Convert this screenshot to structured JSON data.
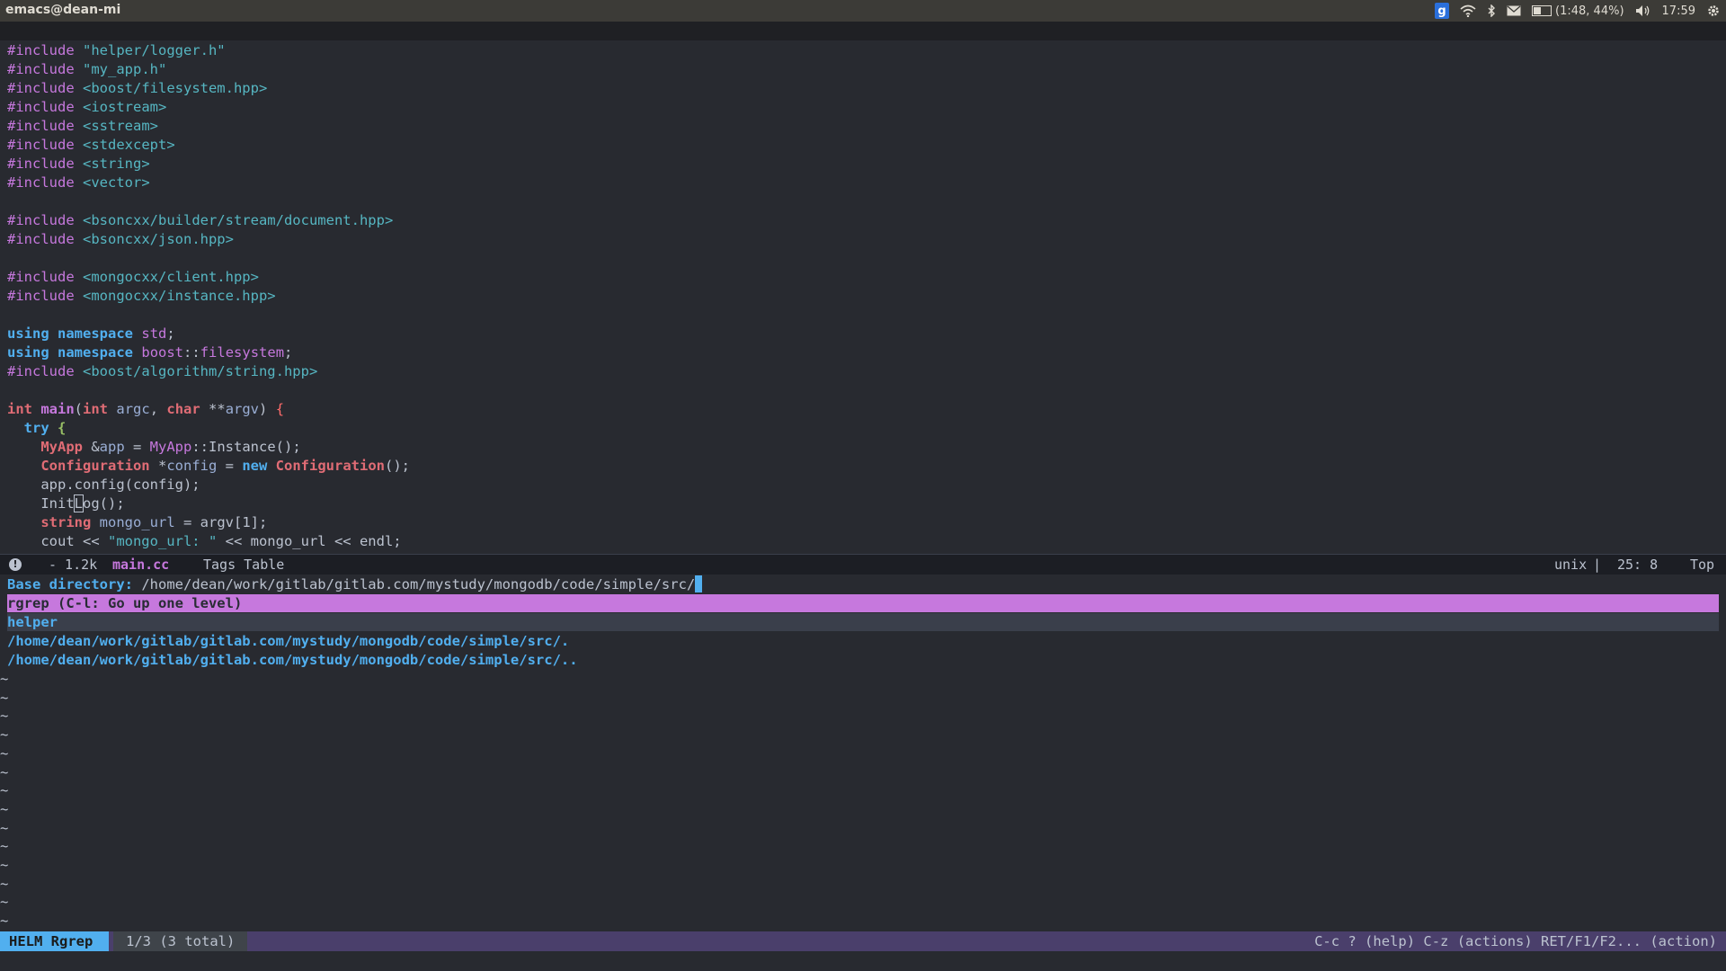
{
  "topbar": {
    "title": "emacs@dean-mi",
    "battery": "(1:48, 44%)",
    "battery_level": 0.44,
    "time": "17:59",
    "icons": [
      "g-indicator-icon",
      "wifi-icon",
      "bluetooth-icon",
      "mail-icon",
      "battery-icon",
      "volume-icon",
      "gear-icon"
    ]
  },
  "editor": {
    "lines": [
      [
        {
          "c": "pp",
          "t": "#include "
        },
        {
          "c": "str",
          "t": "\"helper/logger.h\""
        }
      ],
      [
        {
          "c": "pp",
          "t": "#include "
        },
        {
          "c": "str",
          "t": "\"my_app.h\""
        }
      ],
      [
        {
          "c": "pp",
          "t": "#include "
        },
        {
          "c": "str",
          "t": "<boost/filesystem.hpp>"
        }
      ],
      [
        {
          "c": "pp",
          "t": "#include "
        },
        {
          "c": "str",
          "t": "<iostream>"
        }
      ],
      [
        {
          "c": "pp",
          "t": "#include "
        },
        {
          "c": "str",
          "t": "<sstream>"
        }
      ],
      [
        {
          "c": "pp",
          "t": "#include "
        },
        {
          "c": "str",
          "t": "<stdexcept>"
        }
      ],
      [
        {
          "c": "pp",
          "t": "#include "
        },
        {
          "c": "str",
          "t": "<string>"
        }
      ],
      [
        {
          "c": "pp",
          "t": "#include "
        },
        {
          "c": "str",
          "t": "<vector>"
        }
      ],
      [],
      [
        {
          "c": "pp",
          "t": "#include "
        },
        {
          "c": "str",
          "t": "<bsoncxx/builder/stream/document.hpp>"
        }
      ],
      [
        {
          "c": "pp",
          "t": "#include "
        },
        {
          "c": "str",
          "t": "<bsoncxx/json.hpp>"
        }
      ],
      [],
      [
        {
          "c": "pp",
          "t": "#include "
        },
        {
          "c": "str",
          "t": "<mongocxx/client.hpp>"
        }
      ],
      [
        {
          "c": "pp",
          "t": "#include "
        },
        {
          "c": "str",
          "t": "<mongocxx/instance.hpp>"
        }
      ],
      [],
      [
        {
          "c": "kw",
          "t": "using"
        },
        {
          "c": "",
          "t": " "
        },
        {
          "c": "kw",
          "t": "namespace"
        },
        {
          "c": "",
          "t": " "
        },
        {
          "c": "ns",
          "t": "std"
        },
        {
          "c": "",
          "t": ";"
        }
      ],
      [
        {
          "c": "kw",
          "t": "using"
        },
        {
          "c": "",
          "t": " "
        },
        {
          "c": "kw",
          "t": "namespace"
        },
        {
          "c": "",
          "t": " "
        },
        {
          "c": "ns",
          "t": "boost"
        },
        {
          "c": "",
          "t": "::"
        },
        {
          "c": "ns",
          "t": "filesystem"
        },
        {
          "c": "",
          "t": ";"
        }
      ],
      [
        {
          "c": "pp",
          "t": "#include "
        },
        {
          "c": "str",
          "t": "<boost/algorithm/string.hpp>"
        }
      ],
      [],
      [
        {
          "c": "type",
          "t": "int"
        },
        {
          "c": "",
          "t": " "
        },
        {
          "c": "fn",
          "t": "main"
        },
        {
          "c": "",
          "t": "("
        },
        {
          "c": "type",
          "t": "int"
        },
        {
          "c": "",
          "t": " "
        },
        {
          "c": "var",
          "t": "argc"
        },
        {
          "c": "",
          "t": ", "
        },
        {
          "c": "type",
          "t": "char"
        },
        {
          "c": "",
          "t": " **"
        },
        {
          "c": "var",
          "t": "argv"
        },
        {
          "c": "",
          "t": ") "
        },
        {
          "c": "br",
          "t": "{"
        }
      ],
      [
        {
          "c": "",
          "t": "  "
        },
        {
          "c": "kw",
          "t": "try"
        },
        {
          "c": "",
          "t": " "
        },
        {
          "c": "green",
          "t": "{"
        }
      ],
      [
        {
          "c": "",
          "t": "    "
        },
        {
          "c": "type",
          "t": "MyApp"
        },
        {
          "c": "",
          "t": " &"
        },
        {
          "c": "var",
          "t": "app"
        },
        {
          "c": "",
          "t": " = "
        },
        {
          "c": "tp",
          "t": "MyApp"
        },
        {
          "c": "",
          "t": "::Instance();"
        }
      ],
      [
        {
          "c": "",
          "t": "    "
        },
        {
          "c": "type",
          "t": "Configuration"
        },
        {
          "c": "",
          "t": " *"
        },
        {
          "c": "var",
          "t": "config"
        },
        {
          "c": "",
          "t": " = "
        },
        {
          "c": "kw",
          "t": "new"
        },
        {
          "c": "",
          "t": " "
        },
        {
          "c": "type",
          "t": "Configuration"
        },
        {
          "c": "",
          "t": "();"
        }
      ],
      [
        {
          "c": "",
          "t": "    app.config(config);"
        }
      ],
      [
        {
          "c": "",
          "t": "    Init"
        },
        {
          "c": "cursor",
          "t": "L"
        },
        {
          "c": "",
          "t": "og();"
        }
      ],
      [
        {
          "c": "",
          "t": "    "
        },
        {
          "c": "type",
          "t": "string"
        },
        {
          "c": "",
          "t": " "
        },
        {
          "c": "var",
          "t": "mongo_url"
        },
        {
          "c": "",
          "t": " = argv[1];"
        }
      ],
      [
        {
          "c": "",
          "t": "    cout << "
        },
        {
          "c": "str",
          "t": "\"mongo_url: \""
        },
        {
          "c": "",
          "t": " << mongo_url << endl;"
        }
      ]
    ]
  },
  "modeline": {
    "info": "!",
    "size": "- 1.2k",
    "filename": "main.cc",
    "mode": "Tags Table",
    "encoding": "unix",
    "position": "25: 8",
    "scroll": "Top"
  },
  "helm": {
    "prompt_label": "Base directory:",
    "prompt_value": "/home/dean/work/gitlab/gitlab.com/mystudy/mongodb/code/simple/src/",
    "header": "rgrep (C-l: Go up one level)",
    "candidates": [
      "helper",
      "/home/dean/work/gitlab/gitlab.com/mystudy/mongodb/code/simple/src/.",
      "/home/dean/work/gitlab/gitlab.com/mystudy/mongodb/code/simple/src/.."
    ],
    "tilde_count": 14,
    "tilde_char": "~",
    "bar": {
      "name": "HELM Rgrep",
      "count": "1/3 (3 total)",
      "keys": "C-c ? (help) C-z (actions) RET/F1/F2... (action)"
    }
  }
}
